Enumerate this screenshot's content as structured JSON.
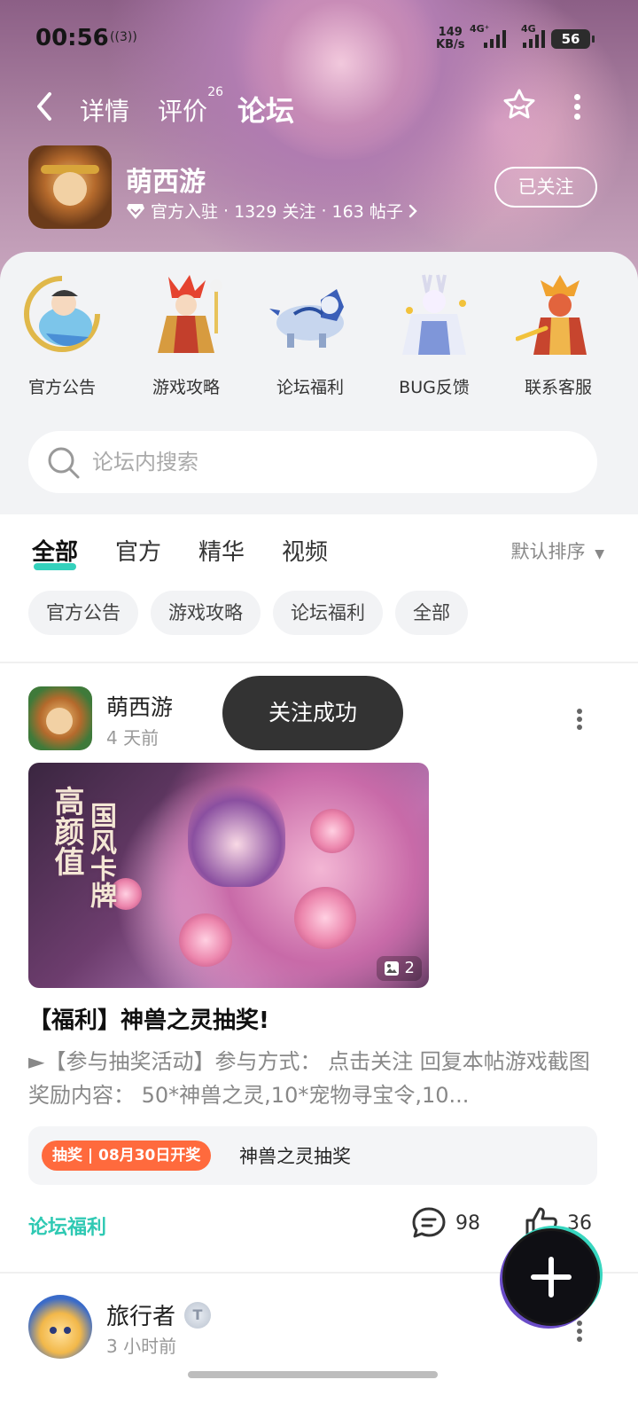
{
  "status_bar": {
    "time": "00:56",
    "hotspot_count": "3",
    "speed_value": "149",
    "speed_unit": "KB/s",
    "net1": "4G⁺",
    "net2": "4G",
    "battery": "56"
  },
  "nav": {
    "tabs": [
      {
        "label": "详情"
      },
      {
        "label": "评价",
        "count": "26"
      },
      {
        "label": "论坛"
      }
    ],
    "active_tab": "论坛"
  },
  "game": {
    "name": "萌西游",
    "verified": "官方入驻",
    "followers": "1329 关注",
    "posts": "163 帖子",
    "follow_button": "已关注"
  },
  "categories": [
    {
      "label": "官方公告",
      "icon": "announcement-hero-icon"
    },
    {
      "label": "游戏攻略",
      "icon": "guide-hero-icon"
    },
    {
      "label": "论坛福利",
      "icon": "welfare-beast-icon"
    },
    {
      "label": "BUG反馈",
      "icon": "bug-feedback-hero-icon"
    },
    {
      "label": "联系客服",
      "icon": "customer-service-hero-icon"
    }
  ],
  "search": {
    "placeholder": "论坛内搜索"
  },
  "feed_tabs": [
    "全部",
    "官方",
    "精华",
    "视频"
  ],
  "feed_active": "全部",
  "sort_label": "默认排序",
  "chips": [
    "官方公告",
    "游戏攻略",
    "论坛福利",
    "全部"
  ],
  "post1": {
    "author": "萌西游",
    "time": "4 天前",
    "image_count": "2",
    "image_text1": "高颜值",
    "image_text2": "国风卡牌",
    "title": "【福利】神兽之灵抽奖!",
    "body": "►【参与抽奖活动】参与方式： 点击关注 回复本帖游戏截图 奖励内容： 50*神兽之灵,10*宠物寻宝令,10...",
    "lottery_tag": "抽奖 | 08月30日开奖",
    "lottery_name": "神兽之灵抽奖",
    "topic": "论坛福利",
    "comments": "98",
    "likes": "36"
  },
  "post2": {
    "author": "旅行者",
    "badge": "T",
    "time": "3 小时前"
  },
  "toast": "关注成功",
  "colors": {
    "accent": "#34d1bc",
    "lottery_tag": "#ff6a3d",
    "toast_bg": "#333333"
  }
}
